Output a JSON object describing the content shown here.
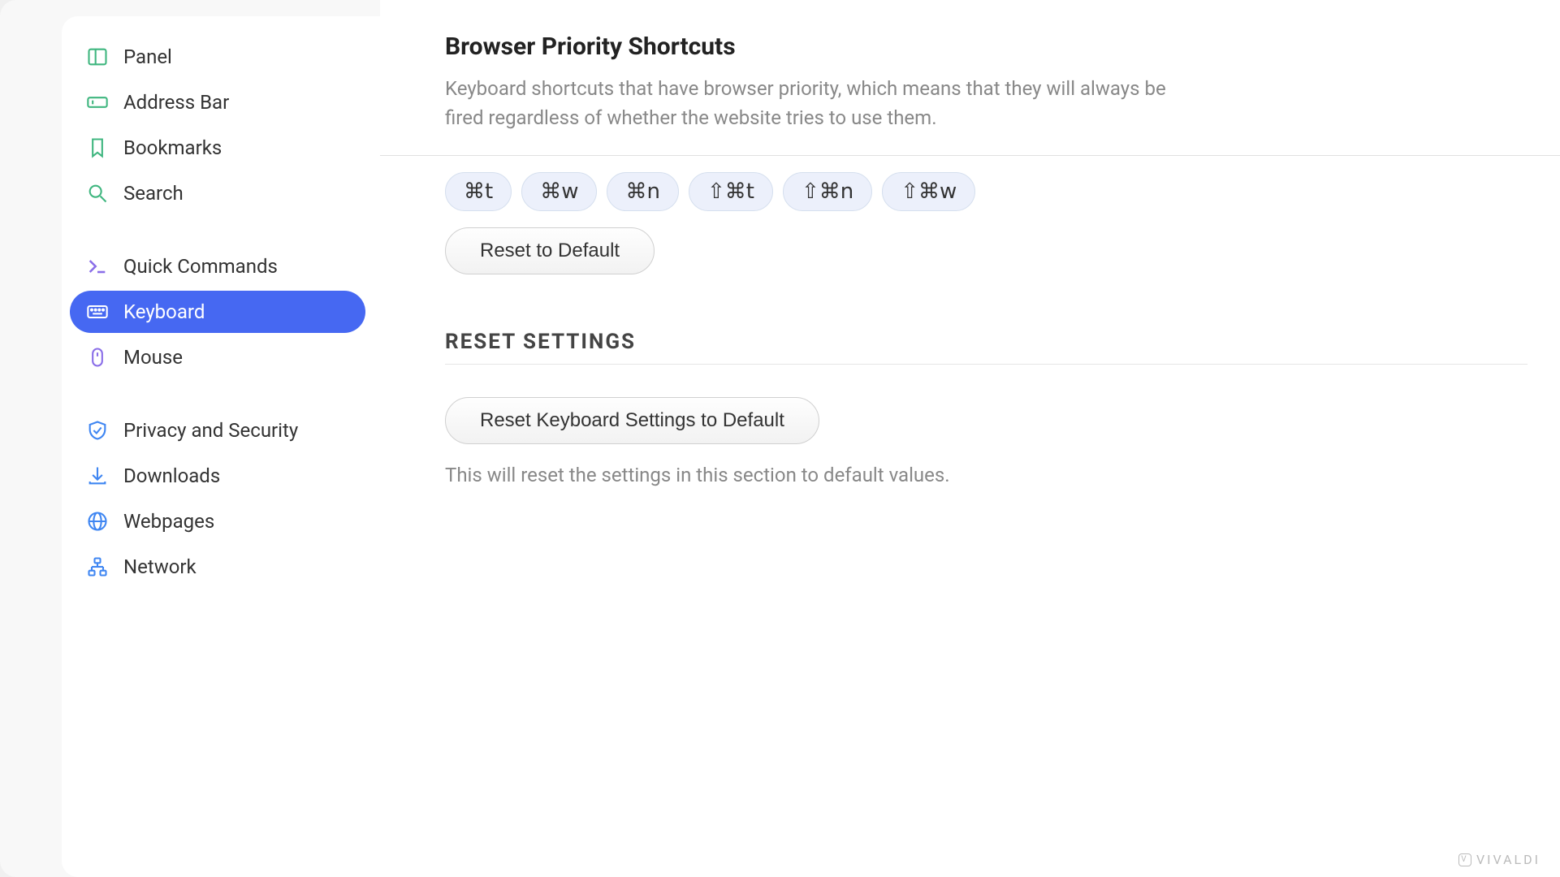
{
  "sidebar": {
    "items": [
      {
        "label": "Panel",
        "icon": "panel-icon"
      },
      {
        "label": "Address Bar",
        "icon": "addressbar-icon"
      },
      {
        "label": "Bookmarks",
        "icon": "bookmark-icon"
      },
      {
        "label": "Search",
        "icon": "search-icon"
      },
      {
        "label": "Quick Commands",
        "icon": "quickcommands-icon"
      },
      {
        "label": "Keyboard",
        "icon": "keyboard-icon",
        "active": true
      },
      {
        "label": "Mouse",
        "icon": "mouse-icon"
      },
      {
        "label": "Privacy and Security",
        "icon": "shield-icon"
      },
      {
        "label": "Downloads",
        "icon": "download-icon"
      },
      {
        "label": "Webpages",
        "icon": "globe-icon"
      },
      {
        "label": "Network",
        "icon": "network-icon"
      }
    ]
  },
  "main": {
    "priority": {
      "title": "Browser Priority Shortcuts",
      "desc": "Keyboard shortcuts that have browser priority, which means that they will always be fired regardless of whether the website tries to use them.",
      "shortcuts": [
        "⌘t",
        "⌘w",
        "⌘n",
        "⇧⌘t",
        "⇧⌘n",
        "⇧⌘w"
      ],
      "reset_btn": "Reset to Default"
    },
    "reset": {
      "header": "RESET SETTINGS",
      "btn": "Reset Keyboard Settings to Default",
      "note": "This will reset the settings in this section to default values."
    }
  },
  "brand": "VIVALDI"
}
